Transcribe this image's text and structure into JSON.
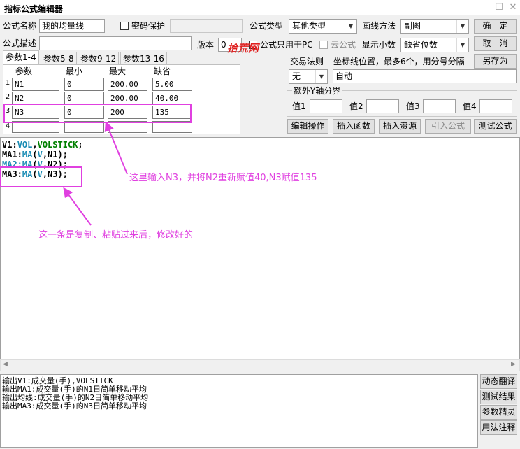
{
  "window": {
    "title": "指标公式编辑器",
    "restore_glyph": "☐",
    "close_glyph": "✕"
  },
  "form": {
    "name_label": "公式名称",
    "name_value": "我的均量线",
    "password_label": "密码保护",
    "desc_label": "公式描述",
    "version_label": "版本",
    "version_value": "0",
    "pc_only_label": "公式只用于PC",
    "cloud_label": "云公式",
    "watermark": "拾荒网",
    "type_label": "公式类型",
    "type_value": "其他类型",
    "draw_label": "画线方法",
    "draw_value": "副图",
    "decimals_label": "显示小数",
    "decimals_value": "缺省位数",
    "trade_rule_label": "交易法则",
    "trade_rule_value": "无",
    "coord_label": "坐标线位置，最多6个，用分号分隔",
    "coord_value": "自动",
    "yaxis_group_label": "额外Y轴分界",
    "yaxis": [
      "值1",
      "值2",
      "值3",
      "值4"
    ]
  },
  "buttons": {
    "ok": "确　定",
    "cancel": "取　消",
    "save_as": "另存为",
    "edit_ops": "编辑操作",
    "insert_func": "插入函数",
    "insert_res": "插入资源",
    "import_formula": "引入公式",
    "test_formula": "测试公式"
  },
  "tabs": [
    "参数1-4",
    "参数5-8",
    "参数9-12",
    "参数13-16"
  ],
  "params": {
    "headers": [
      "参数",
      "最小",
      "最大",
      "缺省"
    ],
    "rows": [
      {
        "num": "1",
        "name": "N1",
        "min": "0",
        "max": "200.00",
        "default": "5.00"
      },
      {
        "num": "2",
        "name": "N2",
        "min": "0",
        "max": "200.00",
        "default": "40.00"
      },
      {
        "num": "3",
        "name": "N3",
        "min": "0",
        "max": "200",
        "default": "135"
      },
      {
        "num": "4",
        "name": "",
        "min": "",
        "max": "",
        "default": ""
      }
    ]
  },
  "code": {
    "lines": [
      [
        {
          "t": "V1:",
          "c": "#000000"
        },
        {
          "t": "VOL",
          "c": "#1a8cb4"
        },
        {
          "t": ",",
          "c": "#000000"
        },
        {
          "t": "VOLSTICK",
          "c": "#008000"
        },
        {
          "t": ";",
          "c": "#000000"
        }
      ],
      [
        {
          "t": "MA1:",
          "c": "#000000"
        },
        {
          "t": "MA",
          "c": "#1a8cb4"
        },
        {
          "t": "(",
          "c": "#000000"
        },
        {
          "t": "V",
          "c": "#1a8cb4"
        },
        {
          "t": ",N1);",
          "c": "#000000"
        }
      ],
      [
        {
          "t": "MA2:",
          "c": "#1a8cb4"
        },
        {
          "t": "MA",
          "c": "#1a8cb4"
        },
        {
          "t": "(",
          "c": "#000000"
        },
        {
          "t": "V",
          "c": "#1a8cb4"
        },
        {
          "t": ",N2);",
          "c": "#000000"
        }
      ],
      [
        {
          "t": "MA3:",
          "c": "#000000"
        },
        {
          "t": "MA",
          "c": "#1a8cb4"
        },
        {
          "t": "(",
          "c": "#000000"
        },
        {
          "t": "V",
          "c": "#1a8cb4"
        },
        {
          "t": ",N3);",
          "c": "#000000"
        }
      ]
    ]
  },
  "annotations": {
    "top": "这里输入N3，并将N2重新赋值40,N3赋值135",
    "bottom": "这一条是复制、粘贴过来后，修改好的",
    "color": "#e040e0"
  },
  "output": {
    "lines": [
      "输出V1:成交量(手),VOLSTICK",
      "输出MA1:成交量(手)的N1日简单移动平均",
      "输出均线:成交量(手)的N2日简单移动平均",
      "输出MA3:成交量(手)的N3日简单移动平均"
    ]
  },
  "side_buttons": [
    "动态翻译",
    "测试结果",
    "参数精灵",
    "用法注释"
  ]
}
